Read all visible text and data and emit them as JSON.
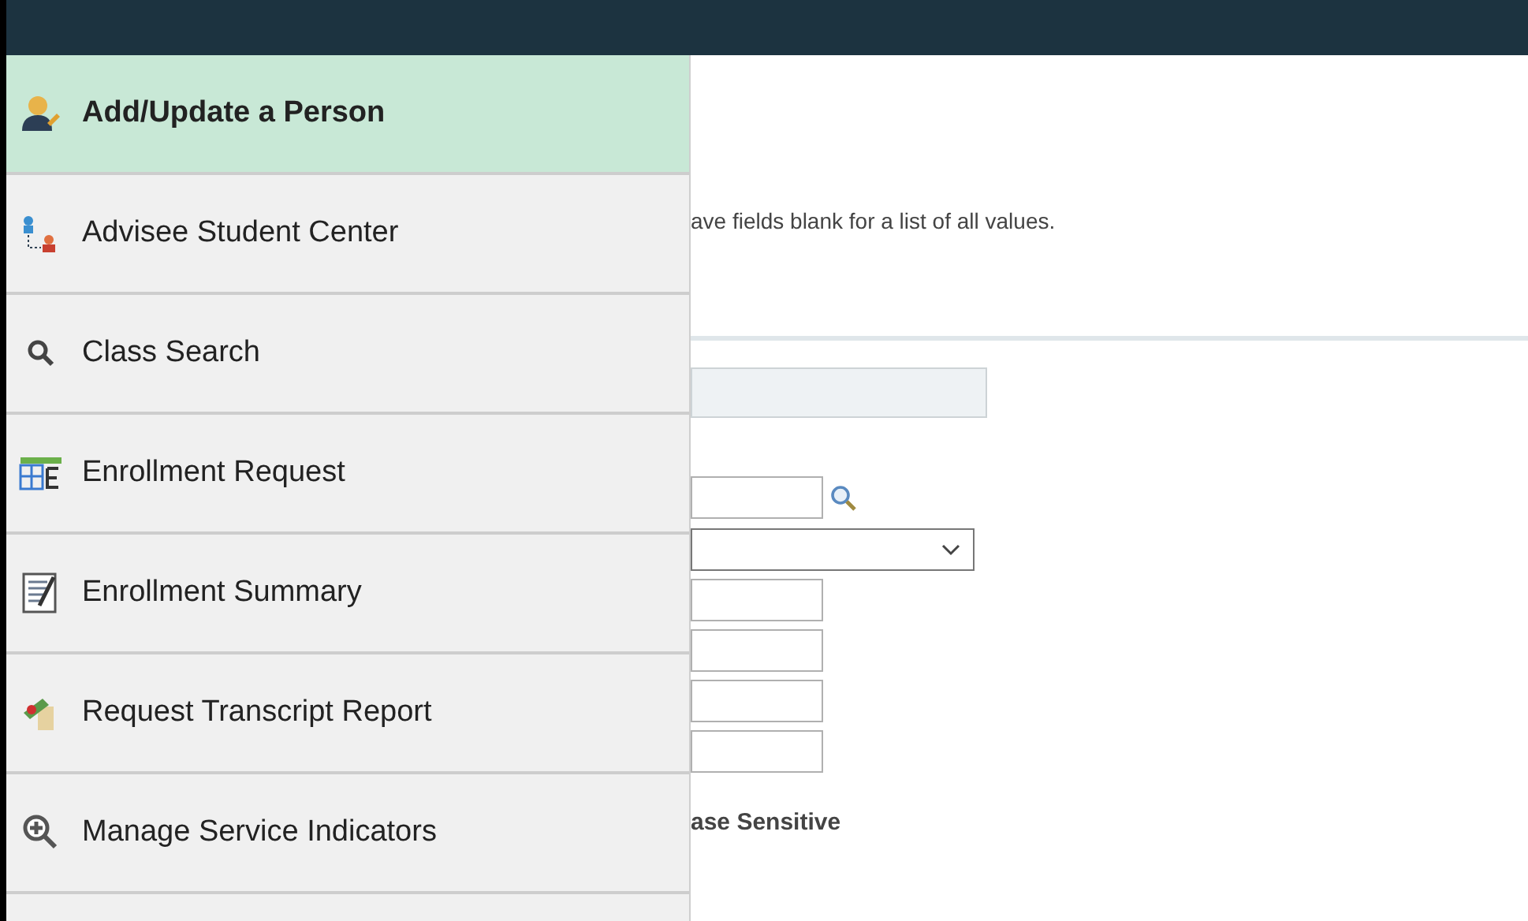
{
  "menu": {
    "items": [
      {
        "label": "Add/Update a Person",
        "kind": "person",
        "selected": true
      },
      {
        "label": "Advisee Student Center",
        "kind": "advisee",
        "selected": false
      },
      {
        "label": "Class Search",
        "kind": "search",
        "selected": false
      },
      {
        "label": "Enrollment Request",
        "kind": "grid",
        "selected": false
      },
      {
        "label": "Enrollment Summary",
        "kind": "notepad",
        "selected": false
      },
      {
        "label": "Request Transcript Report",
        "kind": "diploma",
        "selected": false
      },
      {
        "label": "Manage Service Indicators",
        "kind": "zoom",
        "selected": false
      }
    ]
  },
  "content": {
    "instructions": "ave fields blank for a list of all values.",
    "case_label": "ase Sensitive"
  }
}
